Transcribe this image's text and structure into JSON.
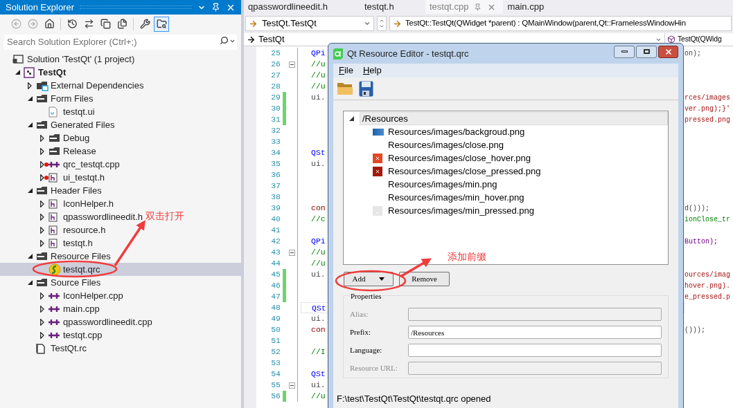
{
  "solution_explorer": {
    "title": "Solution Explorer",
    "toolbar": [
      {
        "kind": "back",
        "disabled": true,
        "selected": false
      },
      {
        "kind": "forward",
        "disabled": true,
        "selected": false
      },
      {
        "kind": "home",
        "disabled": false,
        "selected": false
      },
      {
        "kind": "history",
        "disabled": false,
        "selected": false
      },
      {
        "kind": "sync",
        "disabled": false,
        "selected": false
      },
      {
        "kind": "collapse",
        "disabled": false,
        "selected": false
      },
      {
        "kind": "show-all",
        "disabled": false,
        "selected": false
      },
      {
        "kind": "properties",
        "disabled": false,
        "selected": false
      },
      {
        "kind": "preview",
        "disabled": false,
        "selected": true
      }
    ],
    "search": {
      "placeholder": "Search Solution Explorer (Ctrl+;)"
    },
    "tree": [
      {
        "label": "Solution 'TestQt' (1 project)",
        "kind": "solution",
        "selected": false,
        "excluded": false,
        "children": [
          {
            "label": "TestQt",
            "kind": "project",
            "expanded": true,
            "selected": false,
            "excluded": false,
            "children": [
              {
                "label": "External Dependencies",
                "kind": "deps",
                "expanded": false,
                "selected": false,
                "excluded": false
              },
              {
                "label": "Form Files",
                "kind": "filter",
                "expanded": true,
                "selected": false,
                "excluded": false,
                "children": [
                  {
                    "label": "testqt.ui",
                    "kind": "ui",
                    "selected": false,
                    "excluded": false
                  }
                ]
              },
              {
                "label": "Generated Files",
                "kind": "filter",
                "expanded": true,
                "selected": false,
                "excluded": false,
                "children": [
                  {
                    "label": "Debug",
                    "kind": "folder",
                    "expanded": false,
                    "selected": false,
                    "excluded": false
                  },
                  {
                    "label": "Release",
                    "kind": "folder",
                    "expanded": false,
                    "selected": false,
                    "excluded": false
                  },
                  {
                    "label": "qrc_testqt.cpp",
                    "kind": "cpp",
                    "expanded": false,
                    "selected": false,
                    "excluded": true
                  },
                  {
                    "label": "ui_testqt.h",
                    "kind": "h",
                    "expanded": false,
                    "selected": false,
                    "excluded": true
                  }
                ]
              },
              {
                "label": "Header Files",
                "kind": "filter",
                "expanded": true,
                "selected": false,
                "excluded": false,
                "children": [
                  {
                    "label": "IconHelper.h",
                    "kind": "h",
                    "expanded": false,
                    "selected": false,
                    "excluded": false
                  },
                  {
                    "label": "qpasswordlineedit.h",
                    "kind": "h",
                    "expanded": false,
                    "selected": false,
                    "excluded": false
                  },
                  {
                    "label": "resource.h",
                    "kind": "h",
                    "expanded": false,
                    "selected": false,
                    "excluded": false
                  },
                  {
                    "label": "testqt.h",
                    "kind": "h",
                    "expanded": false,
                    "selected": false,
                    "excluded": false
                  }
                ]
              },
              {
                "label": "Resource Files",
                "kind": "filter",
                "expanded": true,
                "selected": false,
                "excluded": false,
                "children": [
                  {
                    "label": "testqt.qrc",
                    "kind": "qrc",
                    "selected": true,
                    "excluded": false
                  }
                ]
              },
              {
                "label": "Source Files",
                "kind": "filter",
                "expanded": true,
                "selected": false,
                "excluded": false,
                "children": [
                  {
                    "label": "IconHelper.cpp",
                    "kind": "cpp",
                    "expanded": false,
                    "selected": false,
                    "excluded": false
                  },
                  {
                    "label": "main.cpp",
                    "kind": "cpp",
                    "expanded": false,
                    "selected": false,
                    "excluded": false
                  },
                  {
                    "label": "qpasswordlineedit.cpp",
                    "kind": "cpp",
                    "expanded": false,
                    "selected": false,
                    "excluded": false
                  },
                  {
                    "label": "testqt.cpp",
                    "kind": "cpp",
                    "expanded": false,
                    "selected": false,
                    "excluded": false
                  }
                ]
              },
              {
                "label": "TestQt.rc",
                "kind": "rc",
                "selected": false,
                "excluded": false
              }
            ]
          }
        ]
      }
    ]
  },
  "editor": {
    "tabs": [
      {
        "label": "qpasswordlineedit.h",
        "selected": false
      },
      {
        "label": "testqt.h",
        "selected": false
      },
      {
        "label": "testqt.cpp",
        "selected": true
      },
      {
        "label": "main.cpp",
        "selected": false
      }
    ],
    "nav": {
      "type_dropdown": "TestQt.TestQt",
      "member_dropdown": "TestQt::TestQt(QWidget *parent) : QMainWindow(parent,Qt::FramelessWindowHin",
      "scope_dropdown": "TestQt",
      "scope_member": "TestQt(QWidg"
    },
    "lines": [
      {
        "number": "25",
        "changed": false,
        "fold": false,
        "current": false,
        "left": {
          "text": "QPi",
          "kind": "type"
        },
        "right": {
          "text": "on);",
          "kind": "plain"
        }
      },
      {
        "number": "26",
        "changed": false,
        "fold": true,
        "current": false,
        "left": {
          "text": "//u",
          "kind": "comment"
        }
      },
      {
        "number": "27",
        "changed": false,
        "fold": false,
        "current": false,
        "left": {
          "text": "//u",
          "kind": "comment"
        }
      },
      {
        "number": "28",
        "changed": false,
        "fold": false,
        "current": false,
        "left": {
          "text": "//u",
          "kind": "comment"
        }
      },
      {
        "number": "29",
        "changed": true,
        "fold": false,
        "current": false,
        "left": {
          "text": "ui.",
          "kind": "plain"
        },
        "right": {
          "text": "rces/images",
          "kind": "string"
        }
      },
      {
        "number": "30",
        "changed": true,
        "fold": false,
        "current": false,
        "right": {
          "text": "ver.png);}'",
          "kind": "string"
        }
      },
      {
        "number": "31",
        "changed": true,
        "fold": false,
        "current": false,
        "right": {
          "text": "pressed.png",
          "kind": "string"
        }
      },
      {
        "number": "32",
        "changed": false,
        "fold": false,
        "current": false
      },
      {
        "number": "33",
        "changed": false,
        "fold": false,
        "current": false
      },
      {
        "number": "34",
        "changed": false,
        "fold": false,
        "current": false,
        "left": {
          "text": "QSt",
          "kind": "type"
        }
      },
      {
        "number": "35",
        "changed": false,
        "fold": false,
        "current": false,
        "left": {
          "text": "ui.",
          "kind": "plain"
        }
      },
      {
        "number": "36",
        "changed": false,
        "fold": false,
        "current": false
      },
      {
        "number": "37",
        "changed": false,
        "fold": false,
        "current": false
      },
      {
        "number": "38",
        "changed": false,
        "fold": false,
        "current": false
      },
      {
        "number": "39",
        "changed": false,
        "fold": false,
        "current": false,
        "left": {
          "text": "con",
          "kind": "macro"
        },
        "right": {
          "text": "d()));",
          "kind": "plain"
        }
      },
      {
        "number": "40",
        "changed": false,
        "fold": false,
        "current": false,
        "left": {
          "text": "//c",
          "kind": "comment"
        },
        "right": {
          "text": "ionClose_tr",
          "kind": "comment"
        }
      },
      {
        "number": "41",
        "changed": false,
        "fold": false,
        "current": false
      },
      {
        "number": "42",
        "changed": false,
        "fold": false,
        "current": false,
        "left": {
          "text": "QPi",
          "kind": "type"
        },
        "right": {
          "text": "Button);",
          "kind": "enum"
        }
      },
      {
        "number": "43",
        "changed": false,
        "fold": true,
        "current": false,
        "left": {
          "text": "//u",
          "kind": "comment"
        }
      },
      {
        "number": "44",
        "changed": false,
        "fold": false,
        "current": false,
        "left": {
          "text": "//u",
          "kind": "comment"
        }
      },
      {
        "number": "45",
        "changed": true,
        "fold": false,
        "current": false,
        "left": {
          "text": "ui.",
          "kind": "plain"
        },
        "right": {
          "text": "ources/imag",
          "kind": "string"
        }
      },
      {
        "number": "46",
        "changed": true,
        "fold": false,
        "current": false,
        "right": {
          "text": "hover.png).",
          "kind": "string"
        }
      },
      {
        "number": "47",
        "changed": true,
        "fold": false,
        "current": false,
        "right": {
          "text": "e_pressed.p",
          "kind": "string"
        }
      },
      {
        "number": "48",
        "changed": false,
        "fold": false,
        "current": true,
        "left": {
          "text": "QSt",
          "kind": "type"
        }
      },
      {
        "number": "49",
        "changed": false,
        "fold": false,
        "current": false,
        "left": {
          "text": "ui.",
          "kind": "plain"
        }
      },
      {
        "number": "50",
        "changed": false,
        "fold": false,
        "current": false,
        "left": {
          "text": "con",
          "kind": "macro"
        },
        "right": {
          "text": "()));",
          "kind": "plain"
        }
      },
      {
        "number": "51",
        "changed": false,
        "fold": false,
        "current": false
      },
      {
        "number": "52",
        "changed": false,
        "fold": false,
        "current": false,
        "left": {
          "text": "//I",
          "kind": "comment"
        }
      },
      {
        "number": "53",
        "changed": false,
        "fold": false,
        "current": false
      },
      {
        "number": "54",
        "changed": false,
        "fold": false,
        "current": false,
        "left": {
          "text": "QSt",
          "kind": "type"
        }
      },
      {
        "number": "55",
        "changed": false,
        "fold": true,
        "current": false,
        "left": {
          "text": "ui.",
          "kind": "plain"
        }
      },
      {
        "number": "56",
        "changed": true,
        "fold": false,
        "current": false,
        "left": {
          "text": "//u",
          "kind": "comment"
        }
      }
    ]
  },
  "dialog": {
    "title": "Qt Resource Editor - testqt.qrc",
    "menu": [
      "File",
      "Help"
    ],
    "resources": {
      "prefix": "/Resources",
      "expanded": true,
      "selected": true,
      "files": [
        {
          "label": "Resources/images/backgroud.png",
          "kind": "background"
        },
        {
          "label": "Resources/images/close.png",
          "kind": "plain"
        },
        {
          "label": "Resources/images/close_hover.png",
          "kind": "close-hover"
        },
        {
          "label": "Resources/images/close_pressed.png",
          "kind": "close-pressed"
        },
        {
          "label": "Resources/images/min.png",
          "kind": "plain"
        },
        {
          "label": "Resources/images/min_hover.png",
          "kind": "plain"
        },
        {
          "label": "Resources/images/min_pressed.png",
          "kind": "min-pressed"
        }
      ]
    },
    "buttons": [
      {
        "label": "Add",
        "kind": "menu"
      },
      {
        "label": "Remove",
        "kind": "plain"
      }
    ],
    "properties": {
      "title": "Properties",
      "fields": [
        {
          "label": "Alias:",
          "disabled": true
        },
        {
          "label": "Prefix:",
          "disabled": false,
          "value": "/Resources"
        },
        {
          "label": "Language:",
          "disabled": false
        },
        {
          "label": "Resource URL:",
          "disabled": true
        }
      ]
    },
    "status": "F:\\test\\TestQt\\TestQt\\testqt.qrc opened"
  },
  "annotations": [
    {
      "text": "双击打开"
    },
    {
      "text": "添加前缀"
    }
  ]
}
